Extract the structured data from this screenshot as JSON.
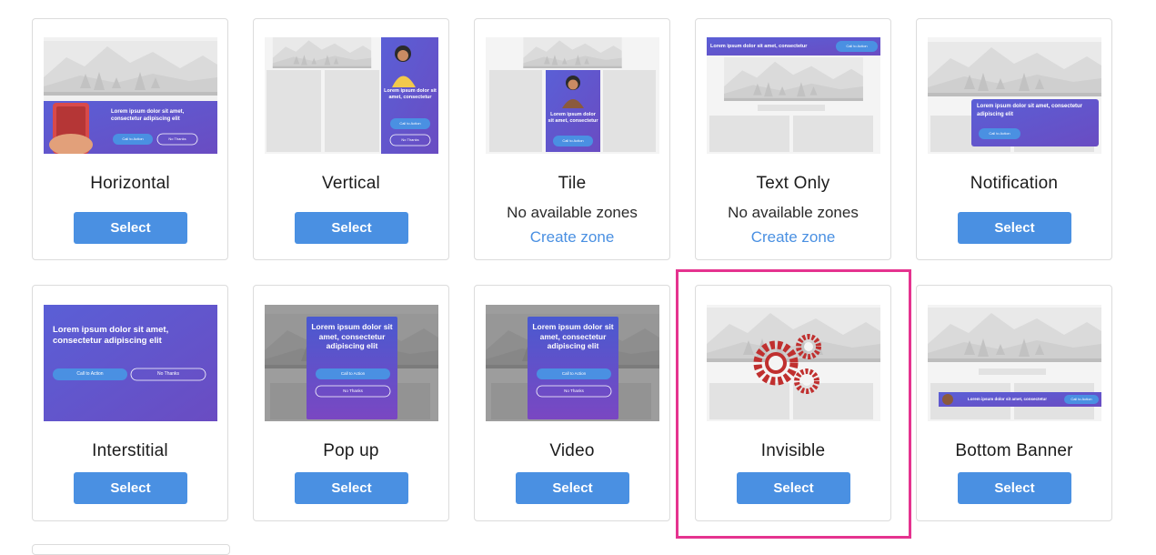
{
  "colors": {
    "accent": "#4a90e2",
    "highlight": "#e5338f",
    "purple": "#5b5bcf"
  },
  "cards": [
    {
      "title": "Horizontal",
      "button": "Select",
      "thumb_text": "Lorem ipsum dolor sit amet, consectetur adipiscing elit",
      "thumb_cta": "Call to Action",
      "thumb_no": "No Thanks"
    },
    {
      "title": "Vertical",
      "button": "Select",
      "thumb_text": "Lorem ipsum dolor sit amet, consectetur",
      "thumb_cta": "Call to Action",
      "thumb_no": "No Thanks"
    },
    {
      "title": "Tile",
      "no_zones": "No available zones",
      "create_zone": "Create zone",
      "thumb_text": "Lorem ipsum dolor sit amet, consectetur",
      "thumb_cta": "Call to Action"
    },
    {
      "title": "Text Only",
      "no_zones": "No available zones",
      "create_zone": "Create zone",
      "thumb_text": "Lorem ipsum dolor sit amet, consectetur",
      "thumb_cta": "Call to Action"
    },
    {
      "title": "Notification",
      "button": "Select",
      "thumb_text": "Lorem ipsum dolor sit amet, consectetur adipiscing elit",
      "thumb_cta": "Call to Action"
    },
    {
      "title": "Interstitial",
      "button": "Select",
      "thumb_text": "Lorem ipsum dolor sit amet, consectetur adipiscing elit",
      "thumb_cta": "Call to Action",
      "thumb_no": "No Thanks"
    },
    {
      "title": "Pop up",
      "button": "Select",
      "thumb_text": "Lorem ipsum dolor sit amet, consectetur adipiscing elit",
      "thumb_cta": "Call to Action",
      "thumb_no": "No Thanks"
    },
    {
      "title": "Video",
      "button": "Select",
      "thumb_text": "Lorem ipsum dolor sit amet, consectetur adipiscing elit",
      "thumb_cta": "Call to Action",
      "thumb_no": "No Thanks"
    },
    {
      "title": "Invisible",
      "button": "Select"
    },
    {
      "title": "Bottom Banner",
      "button": "Select",
      "thumb_text": "Lorem ipsum dolor sit amet, consectetur adipiscing elit",
      "thumb_cta": "Call to Action"
    }
  ]
}
